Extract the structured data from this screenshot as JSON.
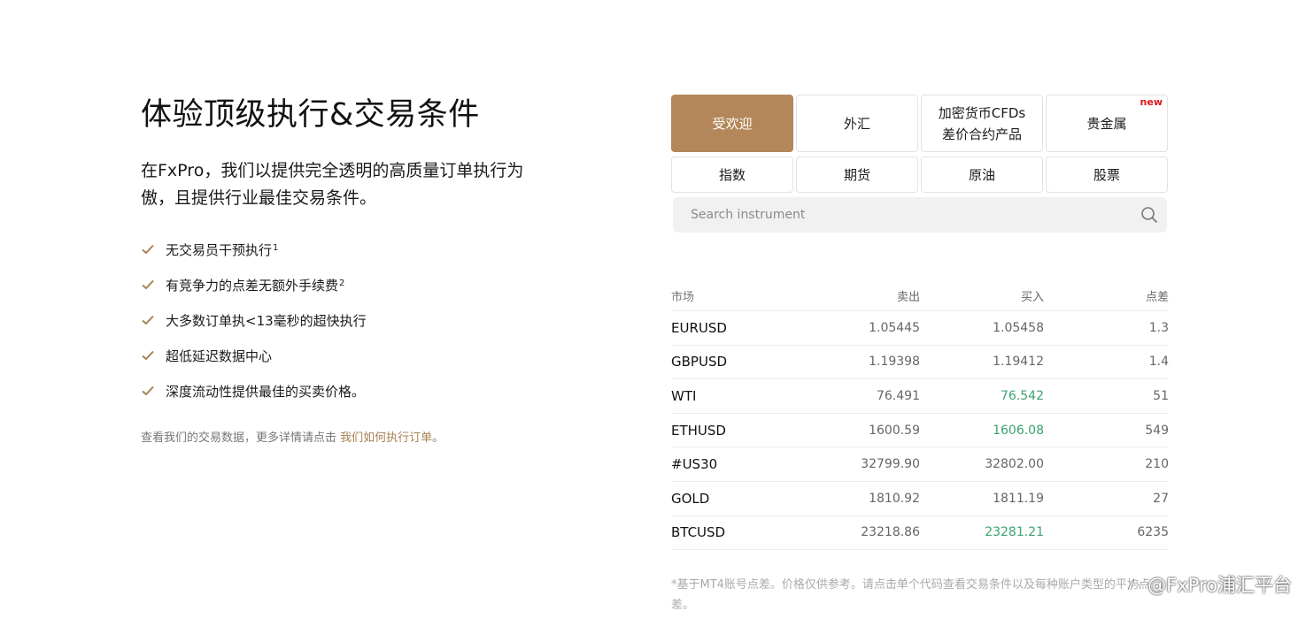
{
  "left": {
    "headline": "体验顶级执行&交易条件",
    "intro": "在FxPro，我们以提供完全透明的高质量订单执行为傲，且提供行业最佳交易条件。",
    "features": [
      {
        "text": "无交易员干预执行",
        "sup": "1"
      },
      {
        "text": "有竞争力的点差无额外手续费",
        "sup": "2"
      },
      {
        "text": "大多数订单执<13毫秒的超快执行",
        "sup": ""
      },
      {
        "text": "超低延迟数据中心",
        "sup": ""
      },
      {
        "text": "深度流动性提供最佳的买卖价格。",
        "sup": ""
      }
    ],
    "footnote_text": "查看我们的交易数据，更多详情请点击",
    "footnote_link": "我们如何执行订单",
    "footnote_end": "。"
  },
  "tabs": {
    "popular": "受欢迎",
    "forex": "外汇",
    "crypto_line1": "加密货币CFDs",
    "crypto_line2": "差价合约产品",
    "metals": "贵金属",
    "metals_badge": "new",
    "indices": "指数",
    "futures": "期货",
    "oil": "原油",
    "stocks": "股票"
  },
  "search": {
    "placeholder": "Search instrument"
  },
  "table": {
    "headers": {
      "market": "市场",
      "sell": "卖出",
      "buy": "买入",
      "spread": "点差"
    },
    "rows": [
      {
        "market": "EURUSD",
        "sell": "1.05445",
        "buy": "1.05458",
        "spread": "1.3"
      },
      {
        "market": "GBPUSD",
        "sell": "1.19398",
        "buy": "1.19412",
        "spread": "1.4"
      },
      {
        "market": "WTI",
        "sell": "76.491",
        "buy": "76.542",
        "spread": "51"
      },
      {
        "market": "ETHUSD",
        "sell": "1600.59",
        "buy": "1606.08",
        "spread": "549"
      },
      {
        "market": "#US30",
        "sell": "32799.90",
        "buy": "32802.00",
        "spread": "210"
      },
      {
        "market": "GOLD",
        "sell": "1810.92",
        "buy": "1811.19",
        "spread": "27"
      },
      {
        "market": "BTCUSD",
        "sell": "23218.86",
        "buy": "23281.21",
        "spread": "6235"
      }
    ],
    "note": "*基于MT4账号点差。价格仅供参考。请点击单个代码查看交易条件以及每种账户类型的平均点差。"
  },
  "watermark": "@FxPro浦汇平台",
  "colors": {
    "accent": "#b4875a",
    "up": "#3aa36e",
    "badge": "#e0141e"
  },
  "icons": {
    "check": "check-icon",
    "search": "search-icon",
    "watermark": "zhihu-logo-icon"
  }
}
